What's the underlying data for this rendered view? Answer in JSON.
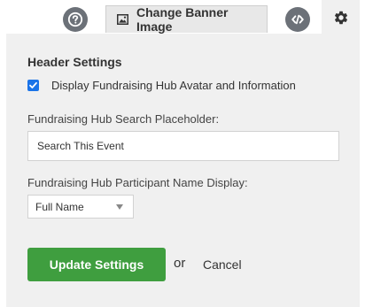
{
  "toolbar": {
    "help_icon": "question-circle-icon",
    "banner_button_label": "Change Banner Image",
    "banner_icon": "image-icon",
    "embed_icon": "code-icon",
    "settings_icon": "gear-icon"
  },
  "panel": {
    "heading": "Header Settings",
    "display_avatar": {
      "label": "Display Fundraising Hub Avatar and Information",
      "checked": true
    },
    "search_placeholder": {
      "label": "Fundraising Hub Search Placeholder:",
      "value": "Search This Event"
    },
    "name_display": {
      "label": "Fundraising Hub Participant Name Display:",
      "selected": "Full Name"
    },
    "update_label": "Update Settings",
    "or_text": "or",
    "cancel_label": "Cancel"
  },
  "colors": {
    "update_button": "#3f9e3f",
    "checkbox": "#1a73e8",
    "icon_button": "#6c7178",
    "panel_bg": "#f0f0f0"
  }
}
